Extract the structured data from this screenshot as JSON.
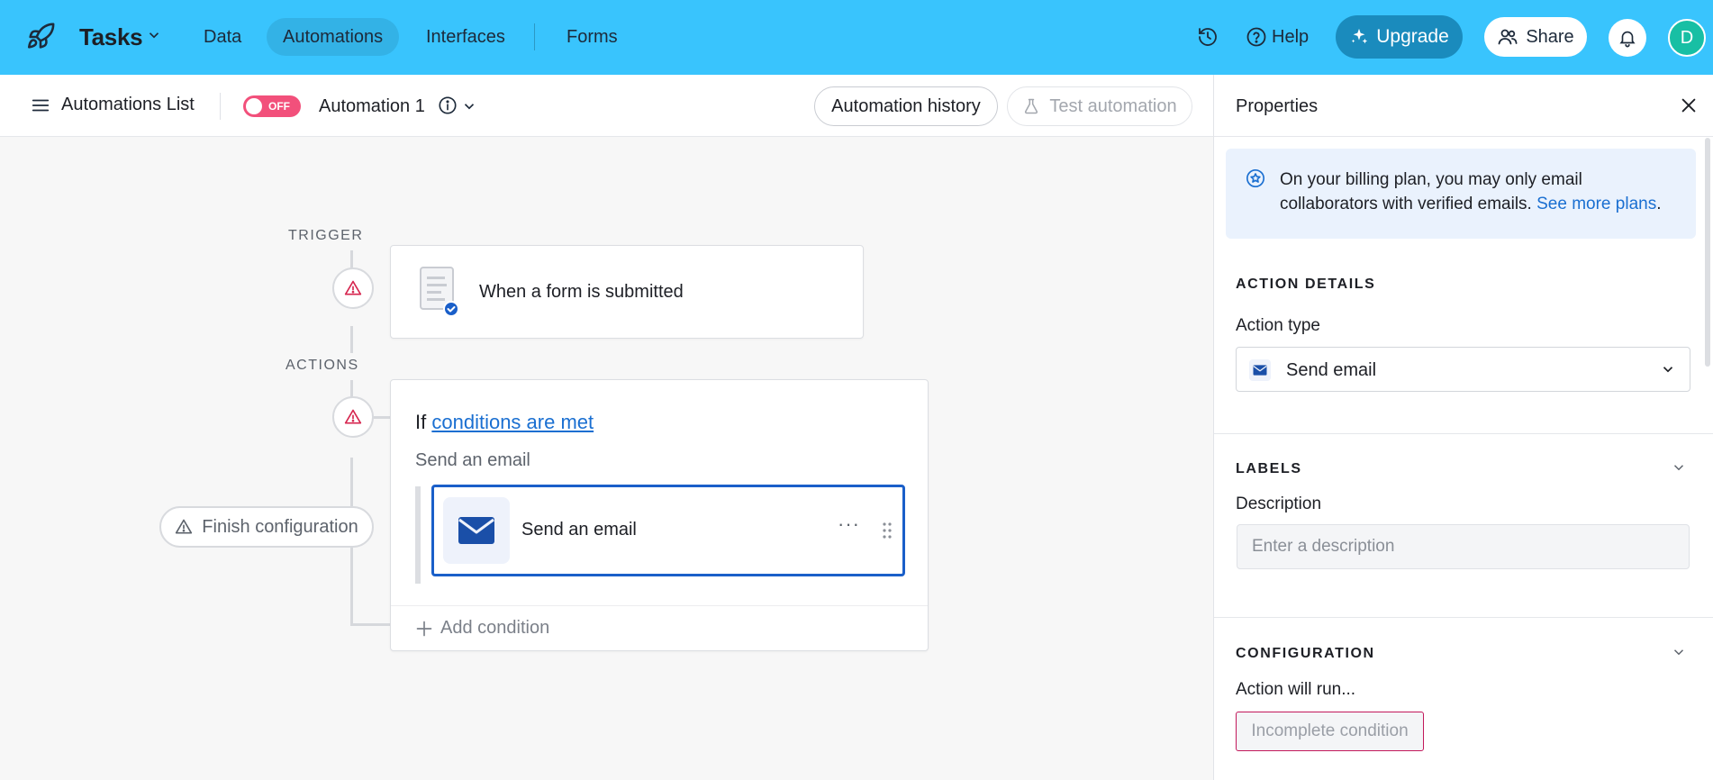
{
  "topbar": {
    "app_title": "Tasks",
    "nav": [
      {
        "label": "Data",
        "active": false
      },
      {
        "label": "Automations",
        "active": true
      },
      {
        "label": "Interfaces",
        "active": false
      },
      {
        "label": "Forms",
        "active": false
      }
    ],
    "icons": {
      "logo": "rocket-icon",
      "history": "history-icon",
      "help": "help-icon",
      "upgrade": "sparkle-icon",
      "share": "users-icon",
      "bell": "bell-icon"
    },
    "help_label": "Help",
    "upgrade_label": "Upgrade",
    "share_label": "Share",
    "avatar_initial": "D",
    "colors": {
      "bar": "#39c4fd",
      "upgrade": "#1a8bbd",
      "avatar": "#18bfa4"
    }
  },
  "subheader": {
    "list_label": "Automations List",
    "toggle_label": "OFF",
    "automation_name": "Automation 1",
    "history_label": "Automation history",
    "test_label": "Test automation"
  },
  "canvas": {
    "trigger_label": "TRIGGER",
    "actions_label": "ACTIONS",
    "trigger_text": "When a form is submitted",
    "if_prefix": "If",
    "if_link": "conditions are met",
    "send_subtitle": "Send an email",
    "email_action_label": "Send an email",
    "more_glyph": "···",
    "add_condition_label": "Add condition",
    "finish_label": "Finish configuration",
    "colors": {
      "warning": "#d6264f",
      "selected_border": "#1a5fc9",
      "toggle_off": "#f2507b"
    }
  },
  "panel": {
    "title": "Properties",
    "banner_text": "On your billing plan, you may only email collaborators with verified emails.",
    "banner_link": "See more plans",
    "banner_end": ".",
    "action_details_heading": "ACTION DETAILS",
    "action_type_label": "Action type",
    "action_type_value": "Send email",
    "labels_heading": "LABELS",
    "description_label": "Description",
    "description_placeholder": "Enter a description",
    "configuration_heading": "CONFIGURATION",
    "action_will_run_label": "Action will run...",
    "incomplete_label": "Incomplete condition"
  }
}
